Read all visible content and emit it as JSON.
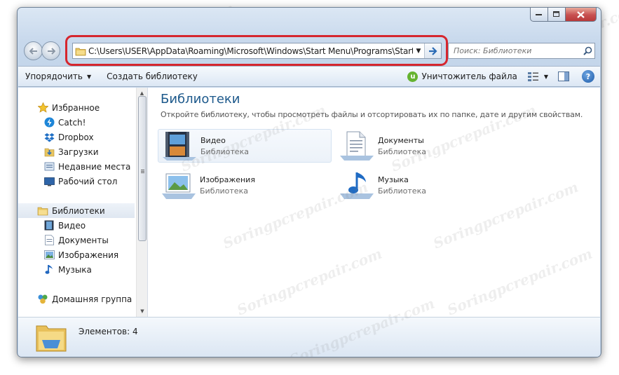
{
  "address": {
    "path": "C:\\Users\\USER\\AppData\\Roaming\\Microsoft\\Windows\\Start Menu\\Programs\\Startup"
  },
  "search": {
    "placeholder": "Поиск: Библиотеки"
  },
  "toolbar": {
    "organize": "Упорядочить",
    "new_library": "Создать библиотеку",
    "utorrent_letter": "u",
    "file_shredder": "Уничтожитель файла",
    "help_glyph": "?"
  },
  "sidebar": {
    "favorites": {
      "label": "Избранное",
      "items": [
        "Catch!",
        "Dropbox",
        "Загрузки",
        "Недавние места",
        "Рабочий стол"
      ]
    },
    "libraries": {
      "label": "Библиотеки",
      "items": [
        "Видео",
        "Документы",
        "Изображения",
        "Музыка"
      ]
    },
    "homegroup": {
      "label": "Домашняя группа"
    }
  },
  "content": {
    "title": "Библиотеки",
    "subtitle": "Откройте библиотеку, чтобы просмотреть файлы и отсортировать их по папке, дате и другим свойствам.",
    "libraries": [
      {
        "name": "Видео",
        "kind": "Библиотека",
        "icon": "video-library-icon"
      },
      {
        "name": "Документы",
        "kind": "Библиотека",
        "icon": "documents-library-icon"
      },
      {
        "name": "Изображения",
        "kind": "Библиотека",
        "icon": "pictures-library-icon"
      },
      {
        "name": "Музыка",
        "kind": "Библиотека",
        "icon": "music-library-icon"
      }
    ]
  },
  "details": {
    "item_count": "Элементов: 4"
  },
  "watermark": "Soringpcrepair.com",
  "colors": {
    "highlight": "#d6262e",
    "title_blue": "#1e5a8c",
    "utorrent_green": "#65b330"
  }
}
